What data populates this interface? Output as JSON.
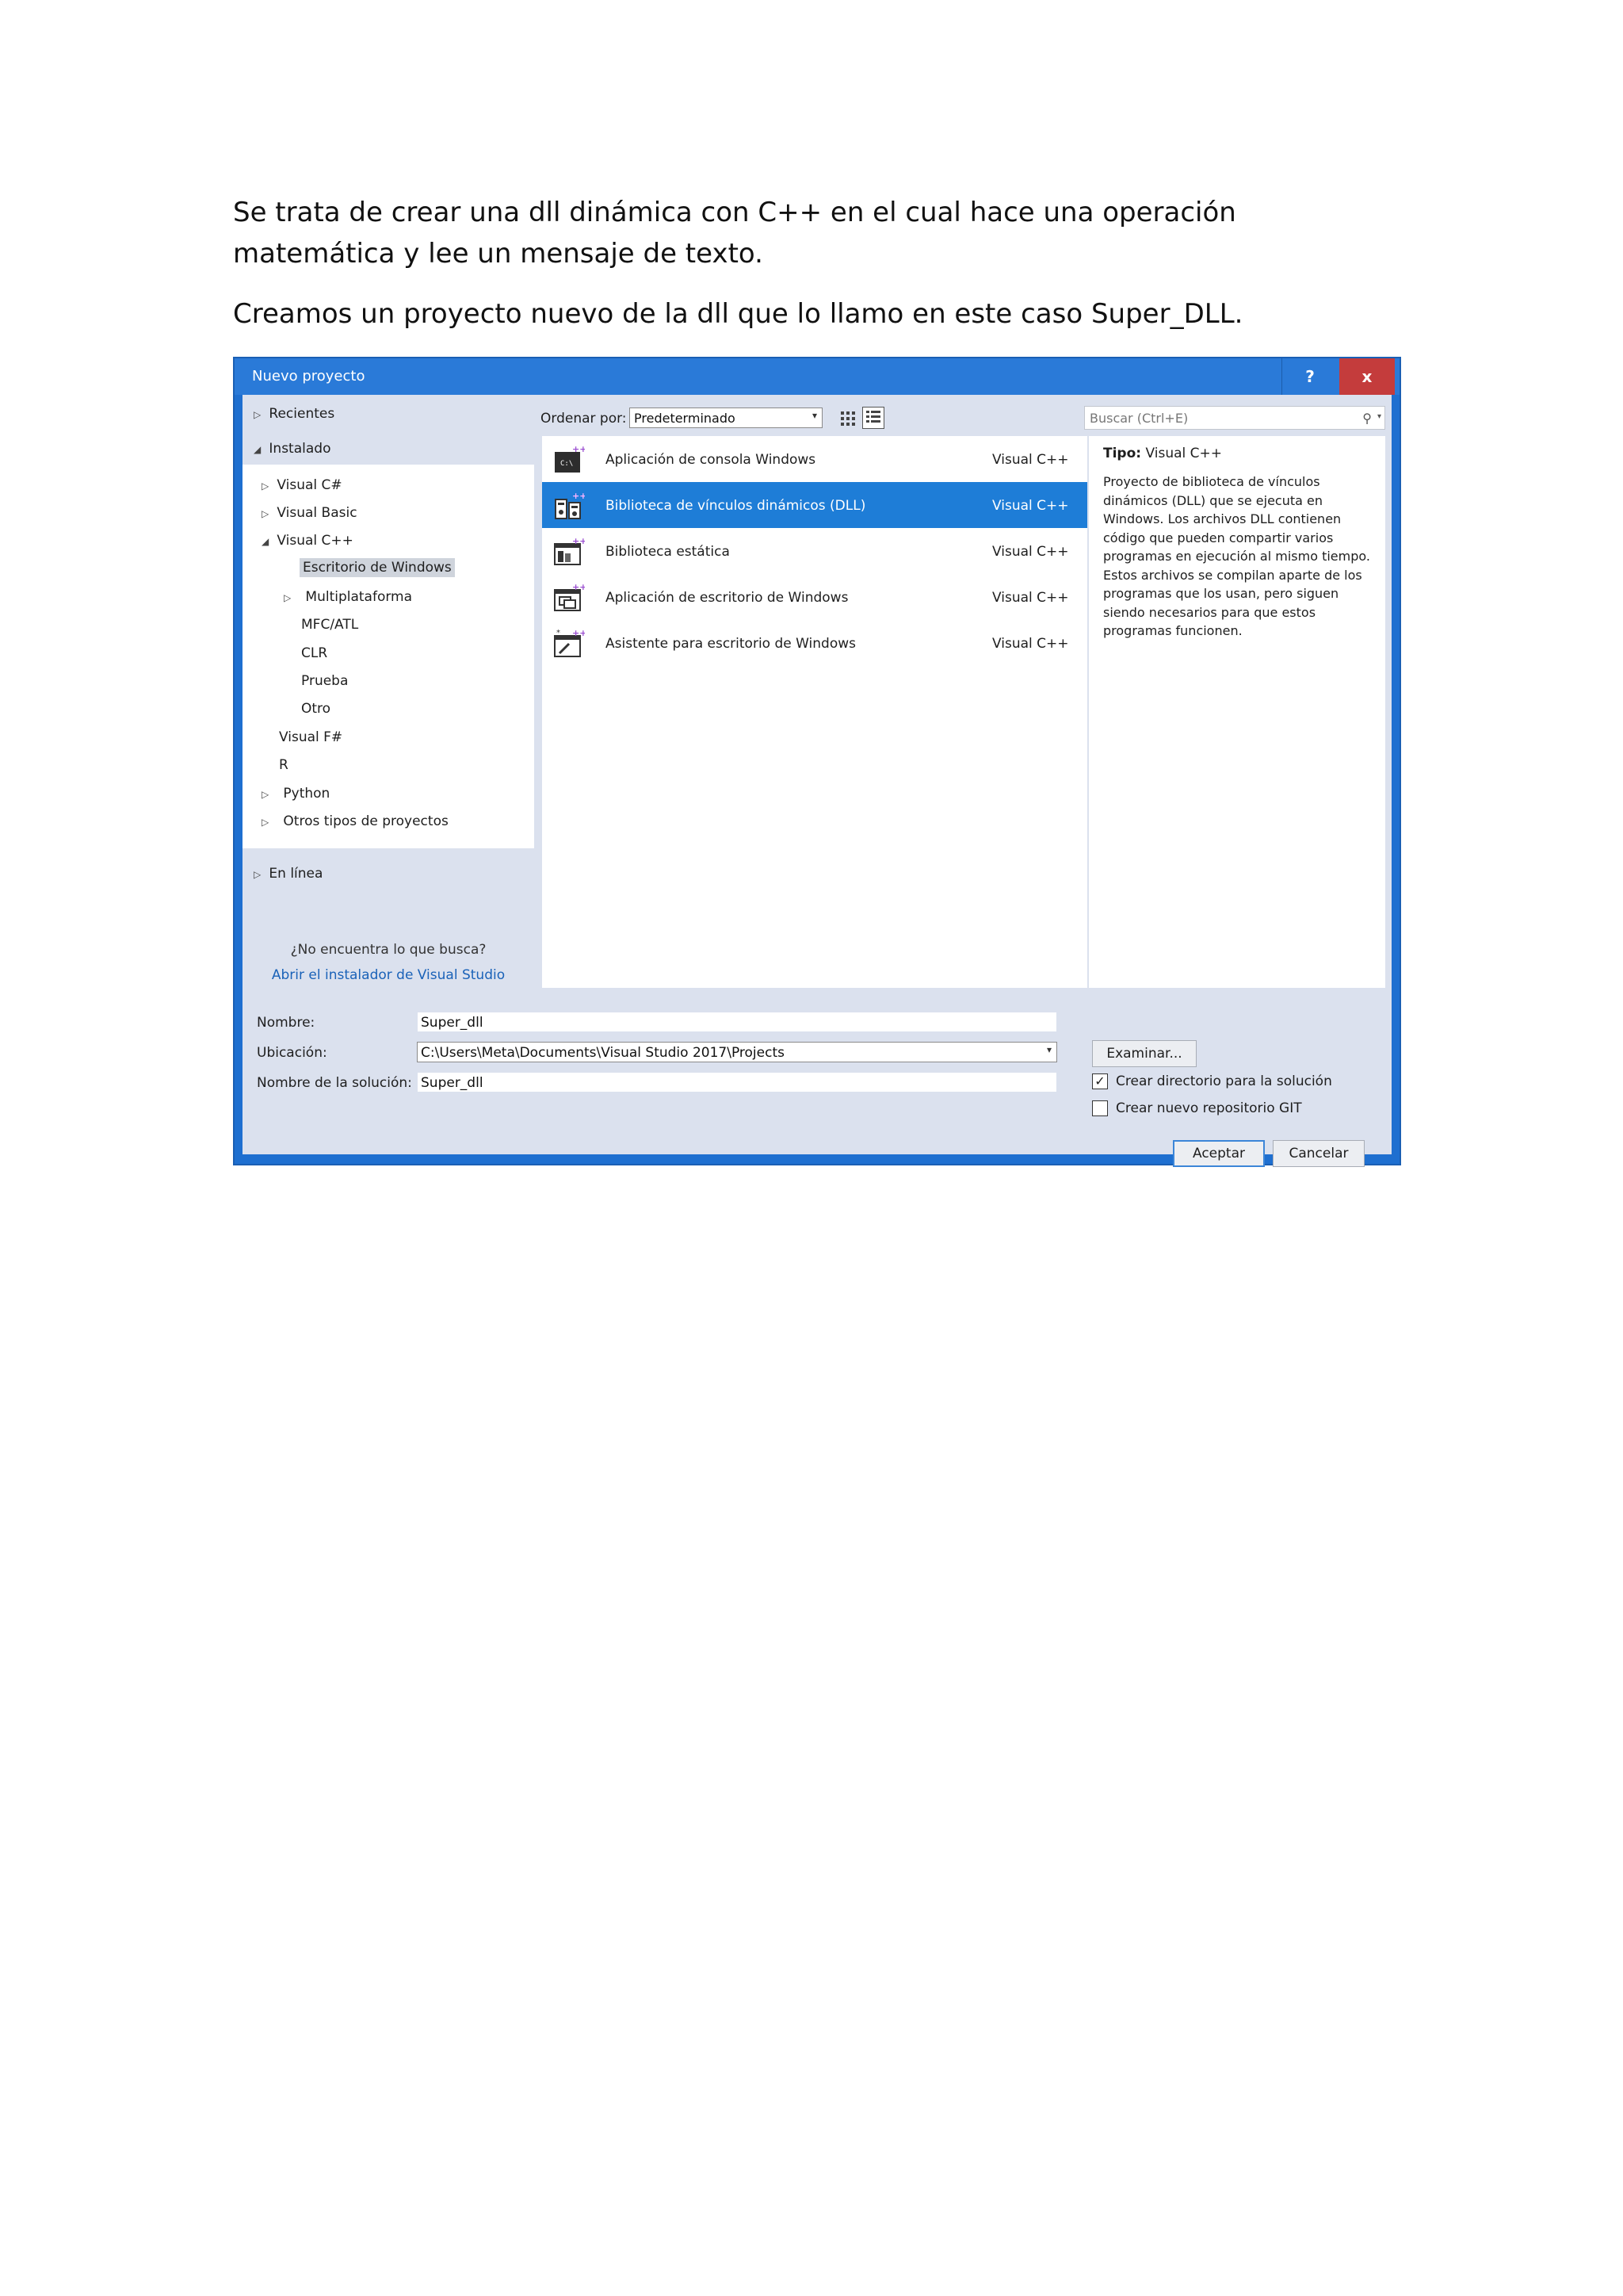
{
  "document": {
    "paragraphs": [
      "Se trata de crear una dll dinámica con C++ en el cual hace una operación matemática y lee un mensaje de texto.",
      "Creamos un proyecto nuevo de la dll que lo llamo en este caso Super_DLL."
    ]
  },
  "dialog": {
    "title": "Nuevo proyecto",
    "help_label": "?",
    "close_label": "x",
    "left": {
      "recent": "Recientes",
      "installed": "Instalado",
      "tree": [
        {
          "label": "Visual C#",
          "expander": "▷"
        },
        {
          "label": "Visual Basic",
          "expander": "▷"
        },
        {
          "label": "Visual C++",
          "expander": "◢"
        },
        {
          "label": "Escritorio de Windows",
          "expander": ""
        },
        {
          "label": "Multiplataforma",
          "expander": "▷"
        },
        {
          "label": "MFC/ATL",
          "expander": ""
        },
        {
          "label": "CLR",
          "expander": ""
        },
        {
          "label": "Prueba",
          "expander": ""
        },
        {
          "label": "Otro",
          "expander": ""
        },
        {
          "label": "Visual F#",
          "expander": ""
        },
        {
          "label": "R",
          "expander": ""
        },
        {
          "label": "Python",
          "expander": "▷"
        },
        {
          "label": "Otros tipos de proyectos",
          "expander": "▷"
        }
      ],
      "online": "En línea",
      "not_found": "¿No encuentra lo que busca?",
      "installer_link": "Abrir el instalador de Visual Studio"
    },
    "toolbar": {
      "sort_label": "Ordenar por:",
      "sort_value": "Predeterminado",
      "search_placeholder": "Buscar (Ctrl+E)"
    },
    "templates": [
      {
        "name": "Aplicación de consola Windows",
        "lang": "Visual C++",
        "icon": "console-app-icon",
        "selected": false
      },
      {
        "name": "Biblioteca de vínculos dinámicos (DLL)",
        "lang": "Visual C++",
        "icon": "dll-icon",
        "selected": true
      },
      {
        "name": "Biblioteca estática",
        "lang": "Visual C++",
        "icon": "static-lib-icon",
        "selected": false
      },
      {
        "name": "Aplicación de escritorio de Windows",
        "lang": "Visual C++",
        "icon": "desktop-app-icon",
        "selected": false
      },
      {
        "name": "Asistente para escritorio de Windows",
        "lang": "Visual C++",
        "icon": "desktop-wizard-icon",
        "selected": false
      }
    ],
    "description": {
      "type_label": "Tipo:",
      "type_value": "Visual C++",
      "lines": [
        "Proyecto de biblioteca de vínculos",
        "dinámicos (DLL) que se ejecuta en",
        "Windows. Los archivos DLL contienen",
        "código que pueden compartir varios",
        "programas en ejecución al mismo tiempo.",
        "Estos archivos se compilan aparte de los",
        "programas que los usan, pero siguen",
        "siendo necesarios para que estos",
        "programas funcionen."
      ]
    },
    "form": {
      "name_label": "Nombre:",
      "name_value": "Super_dll",
      "location_label": "Ubicación:",
      "location_value": "C:\\Users\\Meta\\Documents\\Visual Studio 2017\\Projects",
      "solution_label": "Nombre de la solución:",
      "solution_value": "Super_dll",
      "browse_label": "Examinar...",
      "create_dir_label": "Crear directorio para la solución",
      "create_dir_checked": true,
      "create_git_label": "Crear nuevo repositorio GIT",
      "create_git_checked": false,
      "ok_label": "Aceptar",
      "cancel_label": "Cancelar"
    },
    "colors": {
      "titlebar": "#2a7ad8",
      "close": "#c43c3c",
      "selection": "#1e7dd7",
      "link": "#1a62b8"
    }
  }
}
